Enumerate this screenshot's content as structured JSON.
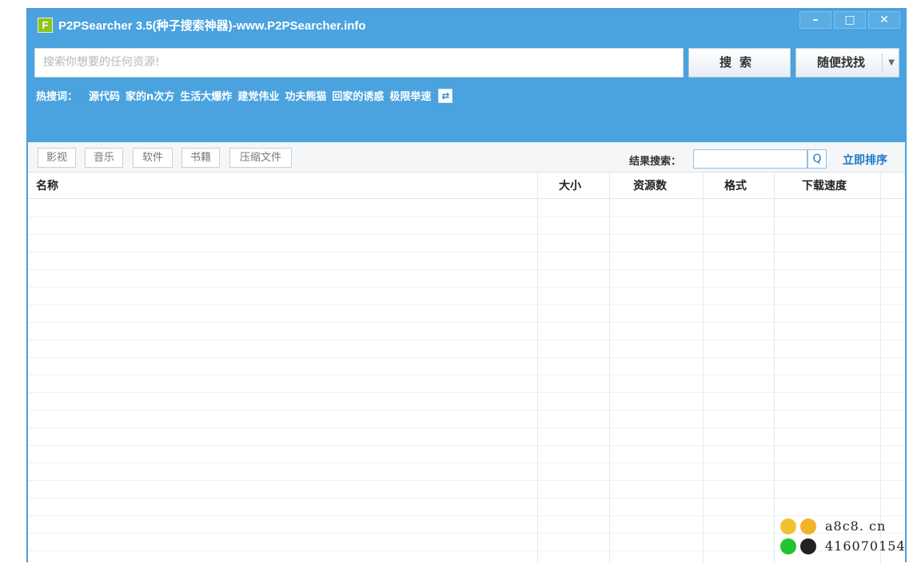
{
  "window": {
    "title": "P2PSearcher 3.5(种子搜索神器)-www.P2PSearcher.info",
    "app_icon_letter": "F",
    "minimize": "–",
    "maximize": "□",
    "close": "✕"
  },
  "search": {
    "placeholder": "搜索你想要的任何资源!",
    "search_button": "搜索",
    "random_button": "随便找找",
    "random_arrow": "▼"
  },
  "hot_words": {
    "label": "热搜词：",
    "items": [
      "源代码",
      "家的n次方",
      "生活大爆炸",
      "建党伟业",
      "功夫熊猫",
      "回家的诱惑",
      "极限举速"
    ]
  },
  "categories": [
    "影视",
    "音乐",
    "软件",
    "书籍",
    "压缩文件"
  ],
  "result_filter": {
    "label": "结果搜索：",
    "search_icon": "Q",
    "sort_link": "立即排序"
  },
  "table": {
    "columns": [
      "名称",
      "大小",
      "资源数",
      "格式",
      "下载速度"
    ]
  },
  "watermark": {
    "site": "a8c8. cn",
    "qq": "416070154"
  }
}
